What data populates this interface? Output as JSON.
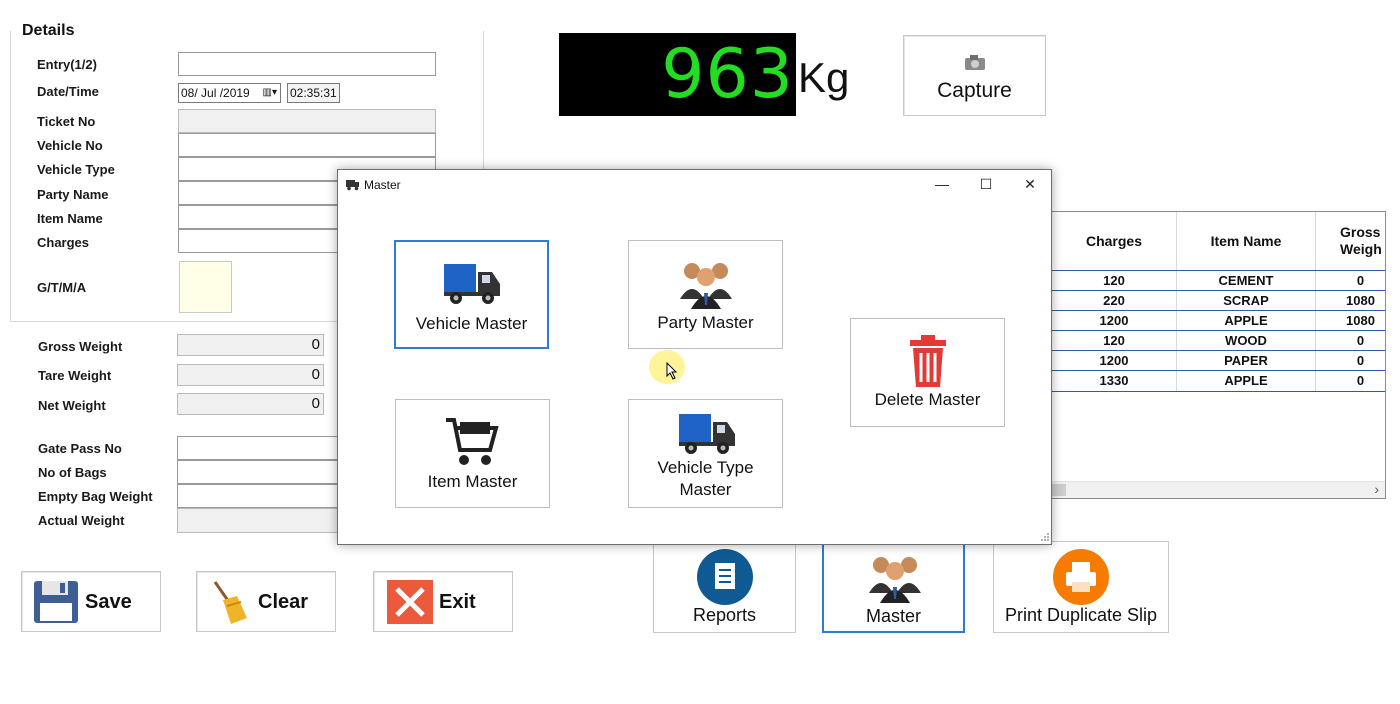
{
  "details": {
    "title": "Details",
    "fields": [
      {
        "label": "Entry(1/2)",
        "value": ""
      },
      {
        "label": "Date/Time",
        "date": "08/ Jul /2019",
        "time": "02:35:31"
      },
      {
        "label": "Ticket No",
        "value": ""
      },
      {
        "label": "Vehicle No",
        "value": ""
      },
      {
        "label": "Vehicle Type",
        "value": ""
      },
      {
        "label": "Party Name",
        "value": ""
      },
      {
        "label": "Item Name",
        "value": ""
      },
      {
        "label": "Charges",
        "value": ""
      },
      {
        "label": "G/T/M/A",
        "value": ""
      }
    ]
  },
  "weights": {
    "gross_label": "Gross Weight",
    "gross": "0",
    "tare_label": "Tare Weight",
    "tare": "0",
    "net_label": "Net Weight",
    "net": "0"
  },
  "extra": {
    "gate_pass_label": "Gate Pass No",
    "bags_label": "No of Bags",
    "empty_bag_label": "Empty Bag Weight",
    "actual_label": "Actual Weight"
  },
  "scale": {
    "reading": "963",
    "unit": "Kg",
    "capture_label": "Capture"
  },
  "grid": {
    "columns": [
      "Charges",
      "Item Name",
      "Gross Weigh"
    ],
    "rows": [
      [
        "120",
        "CEMENT",
        "0"
      ],
      [
        "220",
        "SCRAP",
        "1080"
      ],
      [
        "1200",
        "APPLE",
        "1080"
      ],
      [
        "120",
        "WOOD",
        "0"
      ],
      [
        "1200",
        "PAPER",
        "0"
      ],
      [
        "1330",
        "APPLE",
        "0"
      ]
    ],
    "scroll_right": "›"
  },
  "dialog": {
    "title": "Master",
    "minimize": "—",
    "maximize": "☐",
    "close": "✕",
    "vehicle_master": "Vehicle Master",
    "party_master": "Party Master",
    "delete_master": "Delete Master",
    "item_master": "Item Master",
    "vehicle_type_master_1": "Vehicle Type",
    "vehicle_type_master_2": "Master"
  },
  "bottom": {
    "save": "Save",
    "clear": "Clear",
    "exit": "Exit",
    "reports": "Reports",
    "master": "Master",
    "print_dup": "Print Duplicate Slip"
  },
  "colors": {
    "accent": "#2e7bd6",
    "display_green": "#22dd22",
    "delete_red": "#e53935",
    "reports_blue": "#0f5a93",
    "print_orange": "#f57c00"
  }
}
